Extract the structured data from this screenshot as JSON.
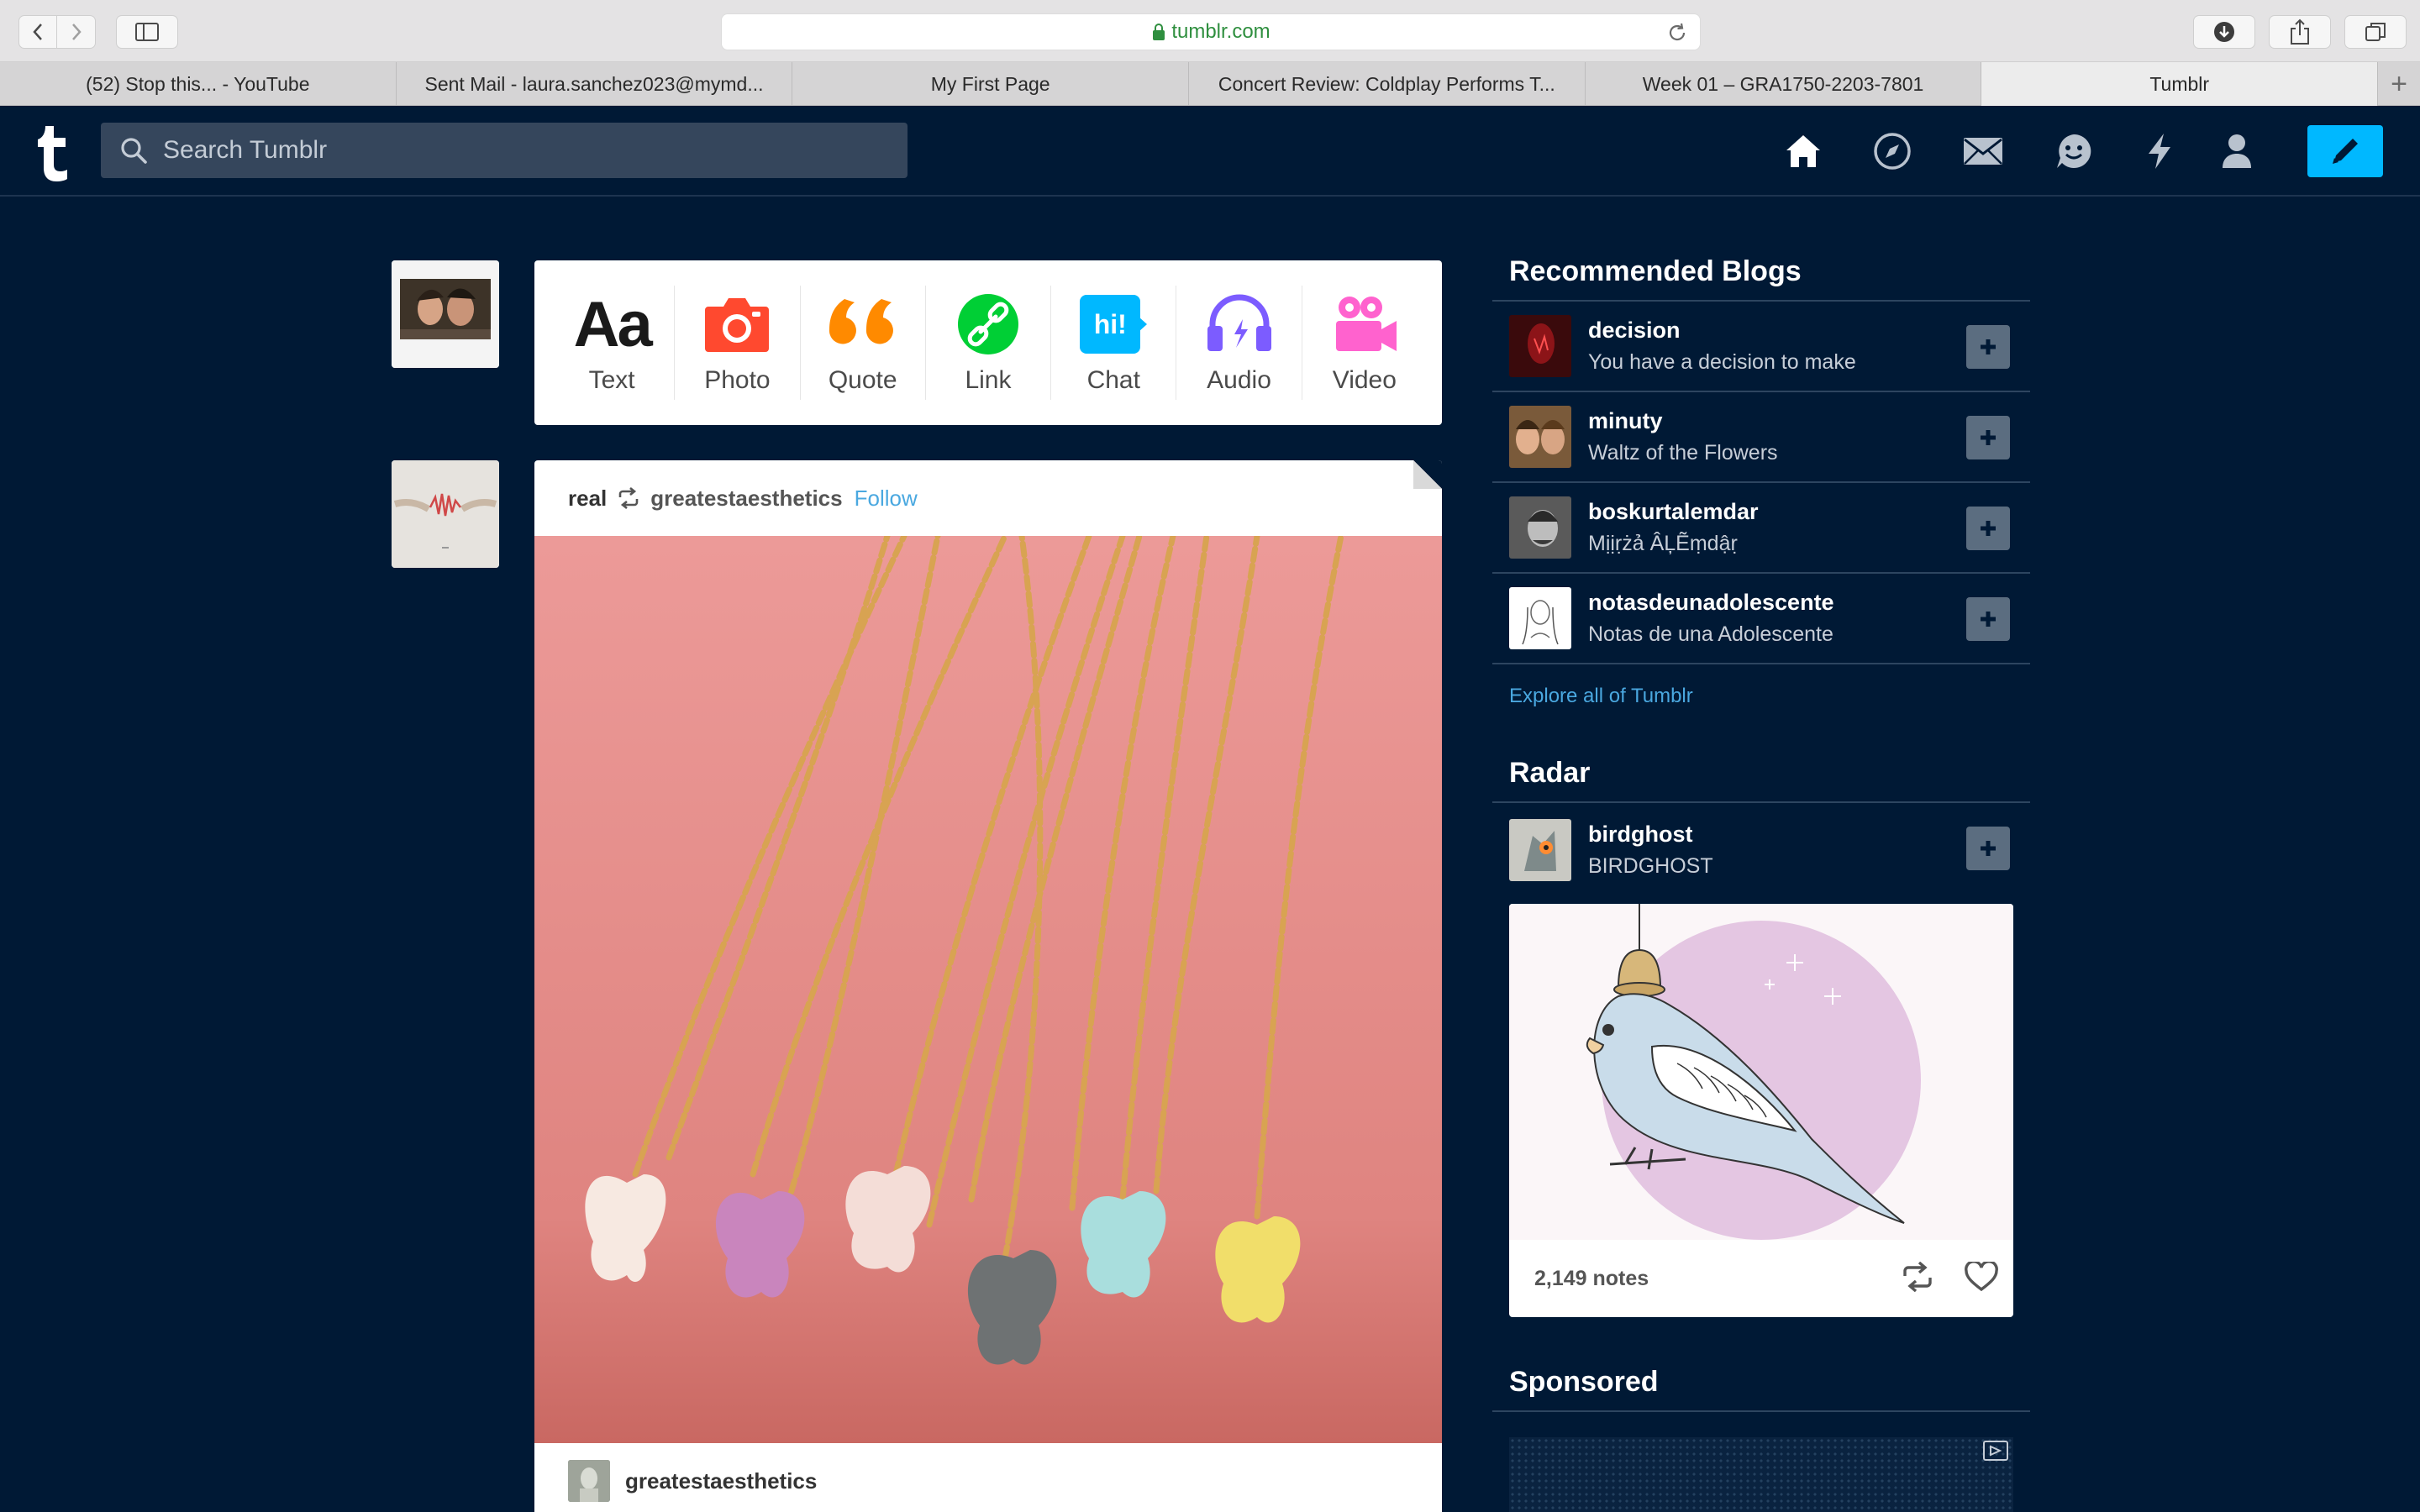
{
  "browser": {
    "url": "tumblr.com",
    "tabs": [
      {
        "title": "(52) Stop this... - YouTube",
        "active": false
      },
      {
        "title": "Sent Mail - laura.sanchez023@mymd...",
        "active": false
      },
      {
        "title": "My First Page",
        "active": false
      },
      {
        "title": "Concert Review: Coldplay Performs T...",
        "active": false
      },
      {
        "title": "Week 01 – GRA1750-2203-7801",
        "active": false
      },
      {
        "title": "Tumblr",
        "active": true
      }
    ],
    "new_tab": "+"
  },
  "header": {
    "logo_letter": "t",
    "search_placeholder": "Search Tumblr",
    "nav_icons": [
      "home-icon",
      "explore-icon",
      "inbox-icon",
      "messaging-icon",
      "activity-icon",
      "account-icon"
    ],
    "compose_icon": "pencil-icon",
    "accent_color": "#00b8ff",
    "background_color": "#001935"
  },
  "composer": {
    "types": [
      {
        "label": "Text",
        "icon": "text-icon",
        "color": "#1a1a1a",
        "glyph": "Aa"
      },
      {
        "label": "Photo",
        "icon": "camera-icon",
        "color": "#ff492f"
      },
      {
        "label": "Quote",
        "icon": "quote-icon",
        "color": "#ff8a00"
      },
      {
        "label": "Link",
        "icon": "link-icon",
        "color": "#00cf35"
      },
      {
        "label": "Chat",
        "icon": "chat-icon",
        "color": "#00b8ff",
        "glyph": "hi!"
      },
      {
        "label": "Audio",
        "icon": "headphones-icon",
        "color": "#7c5cff"
      },
      {
        "label": "Video",
        "icon": "video-camera-icon",
        "color": "#ff62ce"
      }
    ]
  },
  "post": {
    "author": "real",
    "reblog_source": "greatestaesthetics",
    "follow_label": "Follow",
    "image_description": "butterfly-necklaces",
    "footer_source": "greatestaesthetics"
  },
  "sidebar": {
    "recommended_title": "Recommended Blogs",
    "recommended": [
      {
        "name": "decision",
        "title": "You have a decision to make"
      },
      {
        "name": "minuty",
        "title": "Waltz of the Flowers"
      },
      {
        "name": "boskurtalemdar",
        "title": "Mịịṛżả ÂĻẼṃdậṛ"
      },
      {
        "name": "notasdeunadolescente",
        "title": "Notas de una Adolescente"
      }
    ],
    "explore_label": "Explore all of Tumblr",
    "radar_title": "Radar",
    "radar": {
      "name": "birdghost",
      "title": "BIRDGHOST",
      "notes": "2,149 notes"
    },
    "sponsored_title": "Sponsored"
  }
}
